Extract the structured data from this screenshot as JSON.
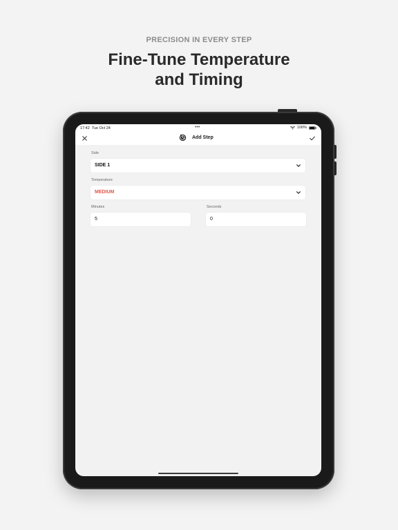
{
  "marketing": {
    "eyebrow": "PRECISION IN EVERY STEP",
    "headline_line1": "Fine-Tune Temperature",
    "headline_line2": "and Timing"
  },
  "status_bar": {
    "time": "17:42",
    "date": "Tue Oct 24",
    "dots": "•••",
    "battery": "100%"
  },
  "nav": {
    "title": "Add Step",
    "close_icon": "close-icon",
    "confirm_icon": "checkmark-icon",
    "logo_icon": "app-logo-icon"
  },
  "form": {
    "side": {
      "label": "Side",
      "value": "SIDE 1"
    },
    "temperature": {
      "label": "Temperature",
      "value": "MEDIUM",
      "value_color": "#e0584a"
    },
    "minutes": {
      "label": "Minutes",
      "value": "5"
    },
    "seconds": {
      "label": "Seconds",
      "value": "0"
    }
  },
  "colors": {
    "accent": "#e0584a",
    "background": "#f3f3f3",
    "device": "#1a1a1a"
  }
}
